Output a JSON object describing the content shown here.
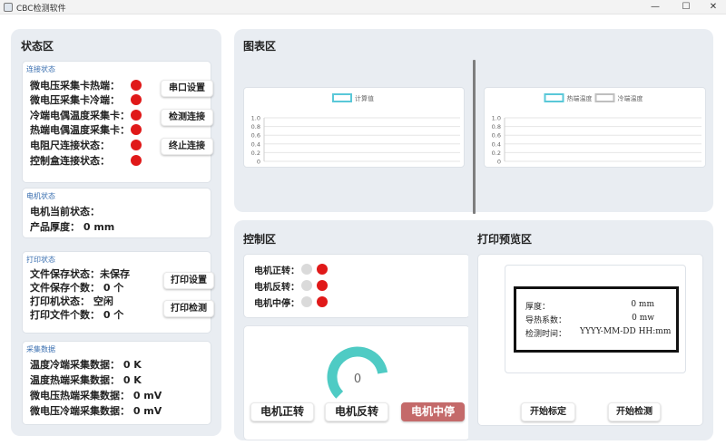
{
  "window": {
    "title": "CBC检测软件",
    "minimize": "—",
    "maximize": "☐",
    "close": "✕"
  },
  "status_panel": {
    "title": "状态区",
    "connection": {
      "title": "连接状态",
      "rows": [
        "微电压采集卡热端：",
        "微电压采集卡冷端：",
        "冷端电偶温度采集卡：",
        "热端电偶温度采集卡：",
        "电阻尺连接状态：",
        "控制盒连接状态："
      ],
      "buttons": {
        "serial": "串口设置",
        "detect": "检测连接",
        "stop": "终止连接"
      }
    },
    "motor": {
      "title": "电机状态",
      "current": "电机当前状态：",
      "thickness": "产品厚度：  0  mm"
    },
    "print": {
      "title": "打印状态",
      "rows": [
        "文件保存状态：未保存",
        "文件保存个数：  0  个",
        "打印机状态：  空闲",
        "打印文件个数：  0  个"
      ],
      "buttons": {
        "settings": "打印设置",
        "test": "打印检测"
      }
    },
    "collect": {
      "title": "采集数据",
      "rows": [
        "温度冷端采集数据：  0  K",
        "温度热端采集数据：  0  K",
        "微电压热端采集数据：  0  mV",
        "微电压冷端采集数据：  0  mV"
      ]
    }
  },
  "chart_panel": {
    "title": "图表区"
  },
  "chart_data": [
    {
      "type": "line",
      "series": [
        {
          "name": "计算值",
          "values": []
        }
      ],
      "ylim": [
        0,
        1.0
      ],
      "yticks": [
        "0",
        "0.2",
        "0.4",
        "0.6",
        "0.8",
        "1.0"
      ],
      "legend": "top-center",
      "legend_color": "#5ac8d8",
      "grid": true
    },
    {
      "type": "line",
      "series": [
        {
          "name": "热端温度",
          "values": []
        },
        {
          "name": "冷端温度",
          "values": []
        }
      ],
      "ylim": [
        0,
        1.0
      ],
      "yticks": [
        "0",
        "0.2",
        "0.4",
        "0.6",
        "0.8",
        "1.0"
      ],
      "legend": "top-center",
      "legend_colors": [
        "#5ac8d8",
        "#bfbfbf"
      ],
      "grid": true
    }
  ],
  "control_panel": {
    "title": "控制区",
    "rows": [
      "电机正转：",
      "电机反转：",
      "电机中停："
    ],
    "gauge": {
      "value": "0",
      "fraction": 0.8,
      "color": "#4fcbc4"
    },
    "buttons": {
      "forward": "电机正转",
      "reverse": "电机反转",
      "stop": "电机中停"
    }
  },
  "preview_panel": {
    "title": "打印预览区",
    "rows": [
      {
        "label": "厚度：",
        "value": "0  mm"
      },
      {
        "label": "导热系数：",
        "value": "0  mw"
      },
      {
        "label": "检测时间：",
        "value": "YYYY-MM-DD  HH:mm"
      }
    ],
    "buttons": {
      "calibrate": "开始标定",
      "detect": "开始检测"
    }
  }
}
